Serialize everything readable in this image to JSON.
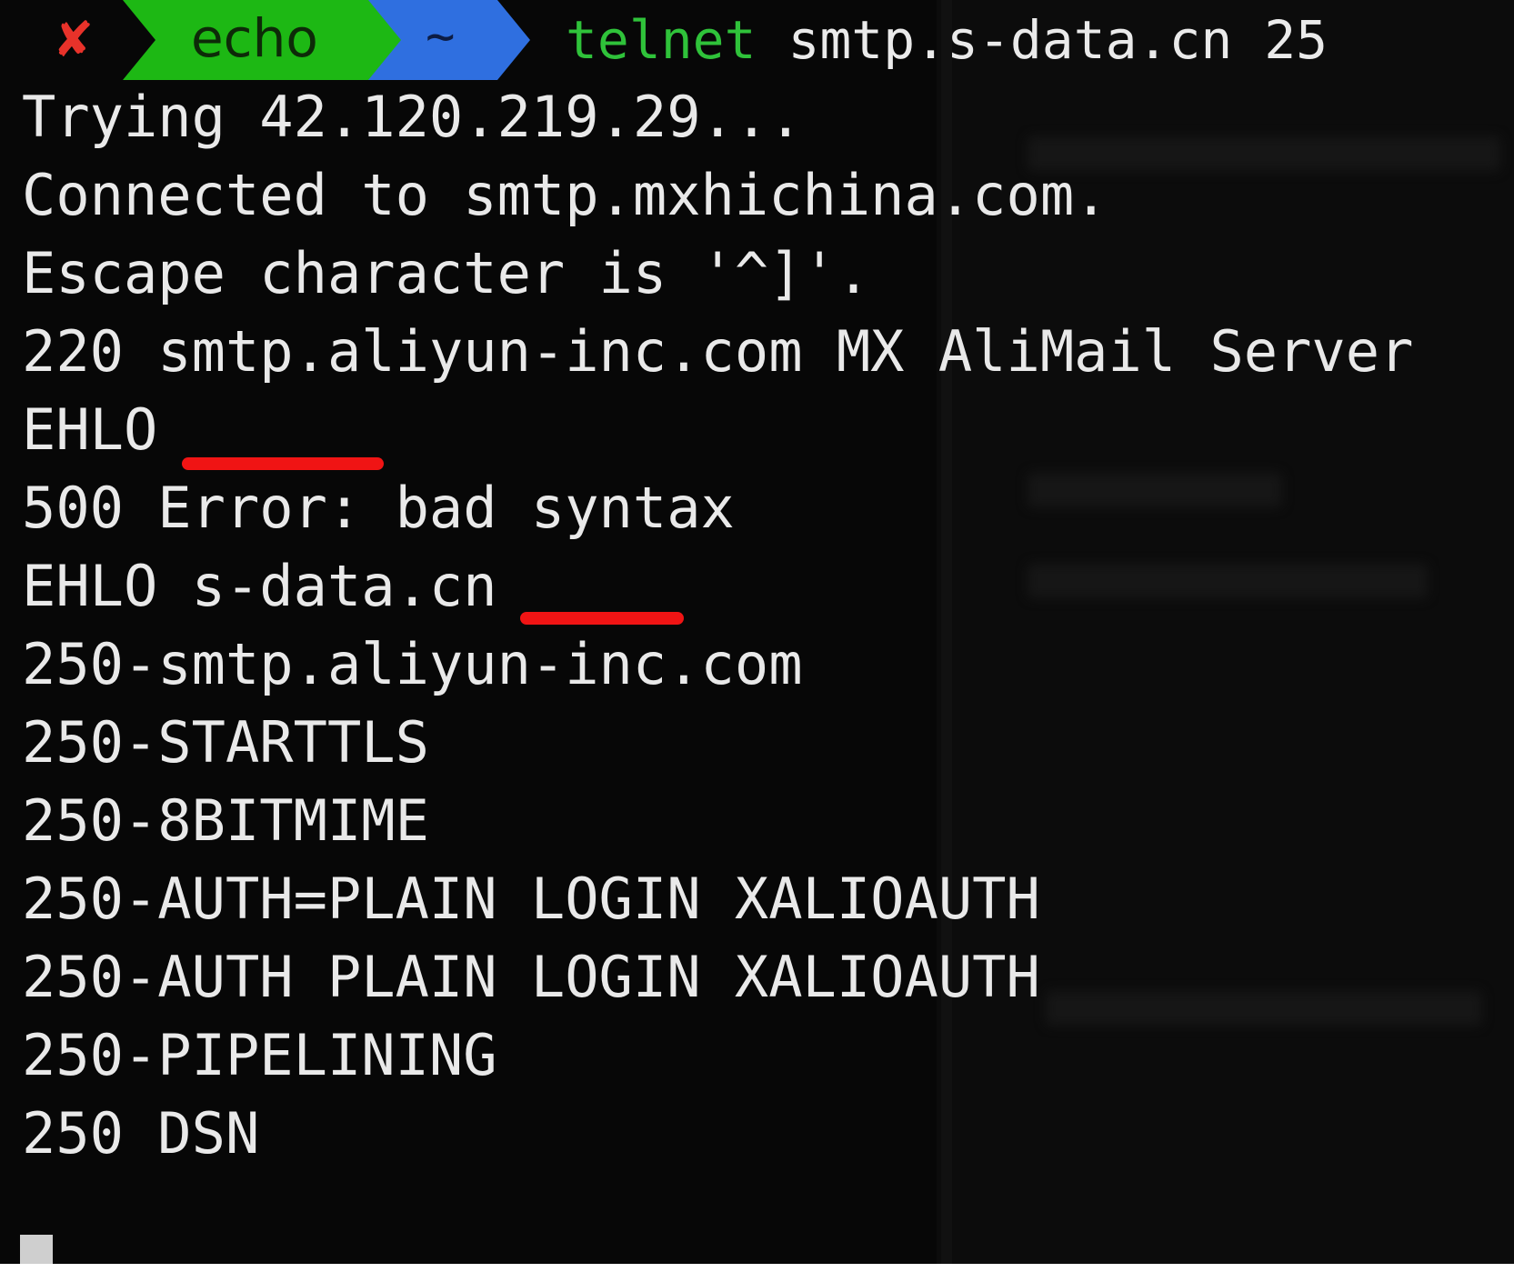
{
  "prompt": {
    "status_icon": "x-icon",
    "status_glyph": "✘",
    "user": "echo",
    "directory": "~",
    "command": "telnet",
    "arguments": "smtp.s-data.cn 25"
  },
  "colors": {
    "status": "#e8322a",
    "user_segment": "#1db814",
    "dir_segment": "#2f6fe0",
    "command": "#2fc23a",
    "annotation": "#f01414"
  },
  "output": [
    "Trying 42.120.219.29...",
    "Connected to smtp.mxhichina.com.",
    "Escape character is '^]'.",
    "220 smtp.aliyun-inc.com MX AliMail Server",
    "EHLO",
    "500 Error: bad syntax",
    "EHLO s-data.cn",
    "250-smtp.aliyun-inc.com",
    "250-STARTTLS",
    "250-8BITMIME",
    "250-AUTH=PLAIN LOGIN XALIOAUTH",
    "250-AUTH PLAIN LOGIN XALIOAUTH",
    "250-PIPELINING",
    "250 DSN"
  ]
}
